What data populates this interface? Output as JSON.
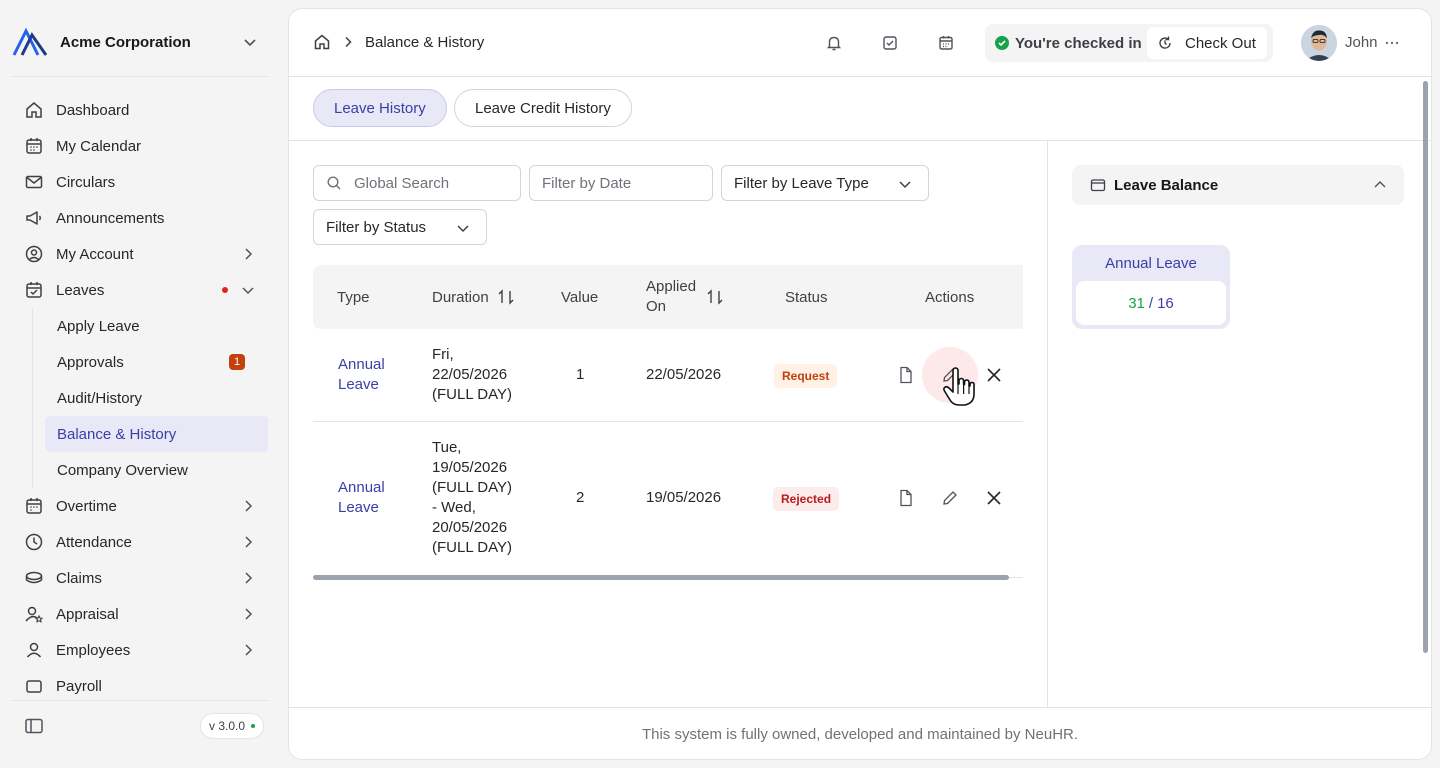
{
  "org": {
    "name": "Acme Corporation"
  },
  "sidebar": {
    "items": [
      {
        "label": "Dashboard",
        "icon": "home-icon"
      },
      {
        "label": "My Calendar",
        "icon": "calendar-icon"
      },
      {
        "label": "Circulars",
        "icon": "mail-icon"
      },
      {
        "label": "Announcements",
        "icon": "megaphone-icon"
      },
      {
        "label": "My Account",
        "icon": "user-circle-icon"
      },
      {
        "label": "Leaves",
        "icon": "calendar-check-icon"
      }
    ],
    "leaves_sub": [
      {
        "label": "Apply Leave"
      },
      {
        "label": "Approvals",
        "badge": "1"
      },
      {
        "label": "Audit/History"
      },
      {
        "label": "Balance & History"
      },
      {
        "label": "Company Overview"
      }
    ],
    "items2": [
      {
        "label": "Overtime",
        "icon": "calendar-clock-icon"
      },
      {
        "label": "Attendance",
        "icon": "clock-icon"
      },
      {
        "label": "Claims",
        "icon": "coins-icon"
      },
      {
        "label": "Appraisal",
        "icon": "user-star-icon"
      },
      {
        "label": "Employees",
        "icon": "user-icon"
      },
      {
        "label": "Payroll",
        "icon": "wallet-icon"
      }
    ],
    "version": "v 3.0.0"
  },
  "breadcrumb": {
    "current": "Balance & History"
  },
  "topbar": {
    "checkin_status": "You're checked in",
    "checkout_label": "Check Out",
    "user_name": "John"
  },
  "tabs": [
    {
      "label": "Leave History",
      "active": true
    },
    {
      "label": "Leave Credit History",
      "active": false
    }
  ],
  "filters": {
    "search_placeholder": "Global Search",
    "date_placeholder": "Filter by Date",
    "leave_type_label": "Filter by Leave Type",
    "status_label": "Filter by Status"
  },
  "table": {
    "headers": {
      "type": "Type",
      "duration": "Duration",
      "value": "Value",
      "applied_on_1": "Applied",
      "applied_on_2": "On",
      "status": "Status",
      "actions": "Actions"
    },
    "rows": [
      {
        "type_1": "Annual",
        "type_2": "Leave",
        "duration": [
          "Fri,",
          "22/05/2026",
          "(FULL DAY)"
        ],
        "value": "1",
        "applied_on": "22/05/2026",
        "status": "Request"
      },
      {
        "type_1": "Annual",
        "type_2": "Leave",
        "duration": [
          "Tue,",
          "19/05/2026",
          "(FULL DAY)",
          "- Wed,",
          "20/05/2026",
          "(FULL DAY)"
        ],
        "value": "2",
        "applied_on": "19/05/2026",
        "status": "Rejected"
      }
    ]
  },
  "leave_balance": {
    "title": "Leave Balance",
    "cards": [
      {
        "title": "Annual Leave",
        "available": "31",
        "slash": "/",
        "total": "16"
      }
    ]
  },
  "footer": {
    "text": "This system is fully owned, developed and maintained by NeuHR."
  },
  "colors": {
    "accent": "#3b3ea8",
    "accent_bg": "#e8e8f6",
    "success": "#16a34a",
    "badge": "#c2410c"
  }
}
